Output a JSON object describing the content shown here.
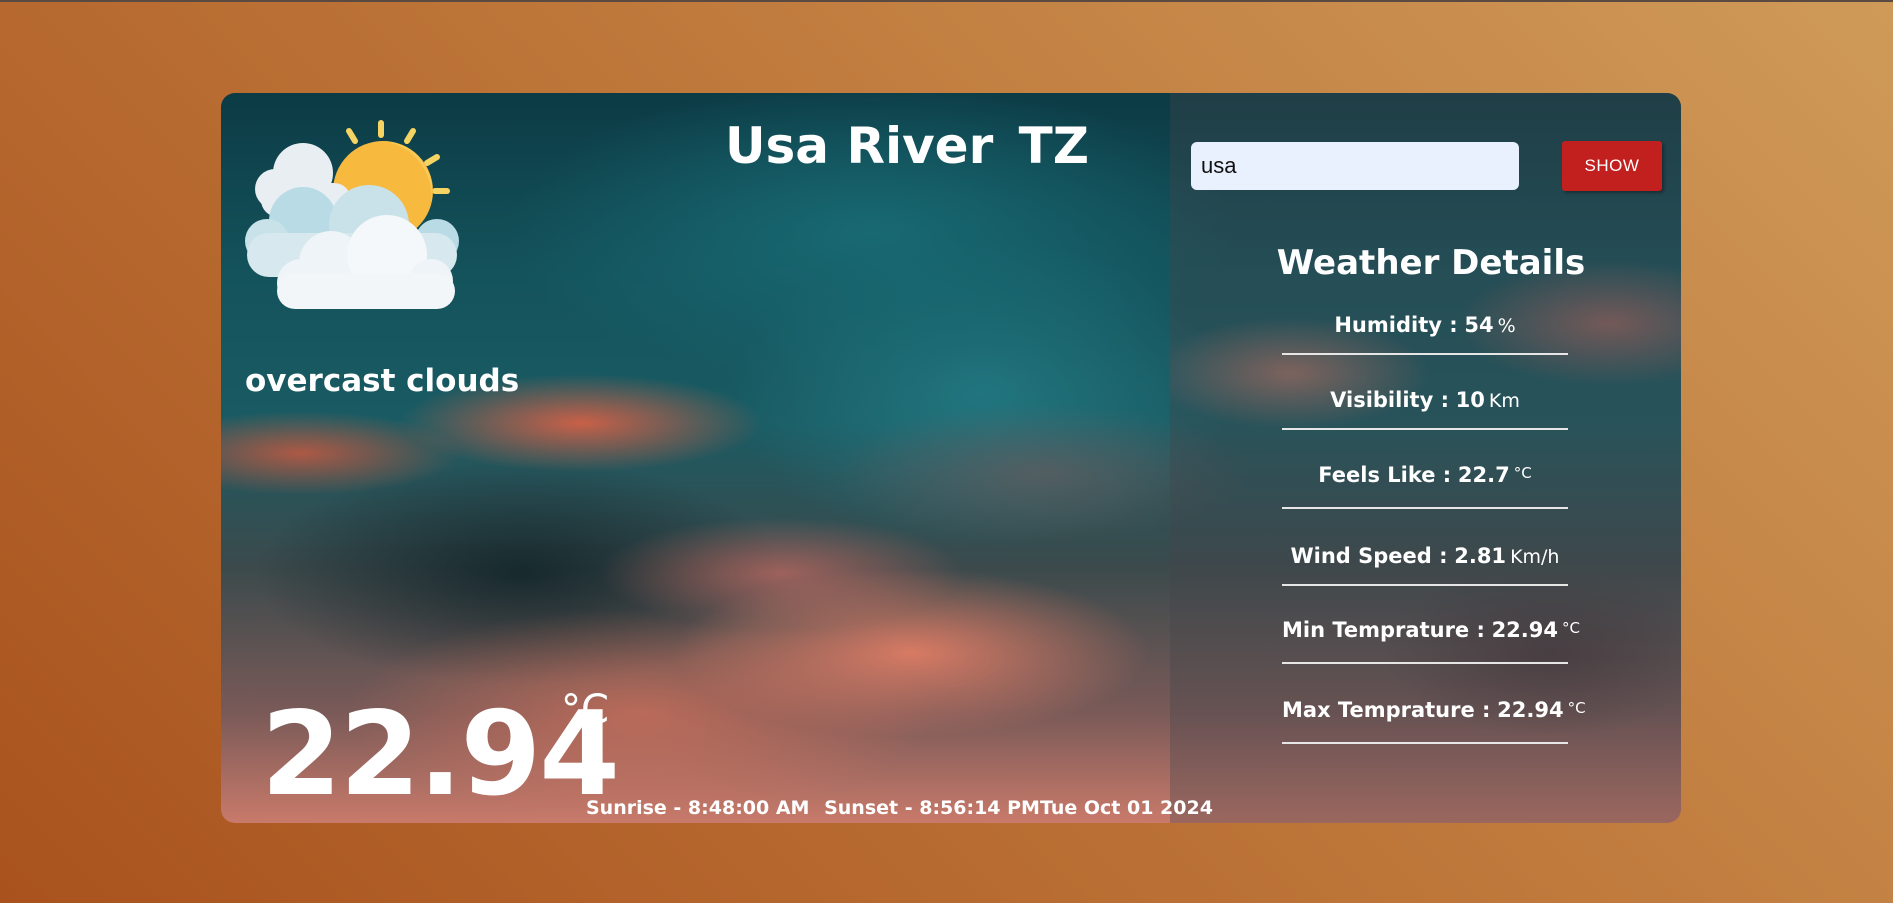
{
  "colors": {
    "background_accent": "#bd7538",
    "button": "#c21f1f",
    "input_bg": "#e9f0fe"
  },
  "main": {
    "city": "Usa River",
    "country": "TZ",
    "description": "overcast clouds",
    "temperature": "22.94",
    "temperature_unit": "°C",
    "sunrise": "Sunrise - 8:48:00 AM",
    "sunset": "Sunset - 8:56:14 PM",
    "date": "Tue Oct 01 2024",
    "icon": "sun-behind-clouds-icon"
  },
  "search": {
    "value": "usa",
    "button_label": "SHOW"
  },
  "details": {
    "title": "Weather Details",
    "items": [
      {
        "label": "Humidity :",
        "value": "54",
        "unit": "%"
      },
      {
        "label": "Visibility :",
        "value": "10",
        "unit": "Km"
      },
      {
        "label": "Feels Like :",
        "value": "22.7",
        "unit": "°C"
      },
      {
        "label": "Wind Speed :",
        "value": "2.81",
        "unit": "Km/h"
      },
      {
        "label": "Min Temprature :",
        "value": "22.94",
        "unit": "°C"
      },
      {
        "label": "Max Temprature :",
        "value": "22.94",
        "unit": "°C"
      }
    ]
  }
}
